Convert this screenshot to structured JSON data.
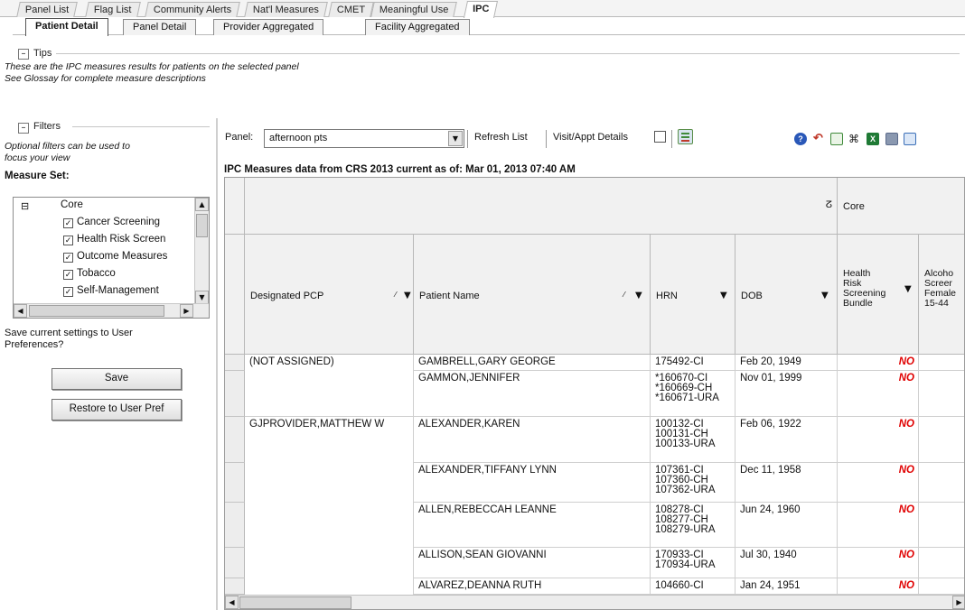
{
  "top_tabs": [
    "Panel List",
    "Flag List",
    "Community Alerts",
    "Nat'l Measures",
    "CMET",
    "Meaningful Use",
    "IPC"
  ],
  "sub_tabs": [
    "Patient Detail",
    "Panel Detail",
    "Provider Aggregated",
    "Facility Aggregated"
  ],
  "tips": {
    "toggle": "–",
    "label": "Tips",
    "line1": "These are the IPC measures results for patients on the selected panel",
    "line2": "See Glossay for complete measure descriptions"
  },
  "filters": {
    "toggle": "–",
    "label": "Filters",
    "desc_line1": "Optional filters can be used to",
    "desc_line2": "focus your view",
    "measure_set_label": "Measure Set:",
    "tree_root": "Core",
    "tree_root_toggle": "⊟",
    "tree_items": [
      "Cancer Screening",
      "Health Risk Screen",
      "Outcome Measures",
      "Tobacco",
      "Self-Management"
    ],
    "check_mark": "✓",
    "save_prompt_line1": "Save current settings to User",
    "save_prompt_line2": "Preferences?",
    "save_button": "Save",
    "restore_button": "Restore  to User Pref"
  },
  "toolbar": {
    "panel_label": "Panel:",
    "panel_value": "afternoon pts",
    "refresh_button": "Refresh List",
    "visit_details_label": "Visit/Appt Details",
    "icons": [
      "export-icon",
      "help-icon",
      "undo-icon",
      "doc-icon",
      "binoculars-icon",
      "excel-icon",
      "print-icon",
      "copy-icon"
    ],
    "colors": {
      "help": "#2a58b8",
      "undo": "#c03a2b",
      "doc": "#3f8a3a",
      "excel": "#1f7a35",
      "print": "#5a6a8a",
      "copy": "#3b6fb8"
    }
  },
  "data_caption": "IPC Measures data  from  CRS 2013 current as of:  Mar 01, 2013 07:40 AM",
  "grid": {
    "group_header": "Core",
    "pin_icon": "ⵒ",
    "filter_glyph": "▼",
    "columns": {
      "pcp": "Designated PCP",
      "patient": "Patient Name",
      "hrn": "HRN",
      "dob": "DOB",
      "hrs_lines": [
        "Health",
        "Risk",
        "Screening",
        "Bundle"
      ],
      "alc_lines": [
        "Alcoho",
        "Screer",
        "Female",
        "15-44"
      ]
    },
    "rows": [
      {
        "pcp": "(NOT ASSIGNED)",
        "patient": "GAMBRELL,GARY GEORGE",
        "hrn": [
          "175492-CI"
        ],
        "dob": "Feb 20, 1949",
        "hrs": "NO"
      },
      {
        "pcp": "",
        "patient": "GAMMON,JENNIFER",
        "hrn": [
          "*160670-CI",
          "*160669-CH",
          "*160671-URA"
        ],
        "dob": "Nov 01, 1999",
        "hrs": "NO"
      },
      {
        "pcp": "GJPROVIDER,MATTHEW W",
        "patient": "ALEXANDER,KAREN",
        "hrn": [
          "100132-CI",
          "100131-CH",
          "100133-URA"
        ],
        "dob": "Feb 06, 1922",
        "hrs": "NO"
      },
      {
        "pcp": "",
        "patient": "ALEXANDER,TIFFANY LYNN",
        "hrn": [
          "107361-CI",
          "107360-CH",
          "107362-URA"
        ],
        "dob": "Dec 11, 1958",
        "hrs": "NO"
      },
      {
        "pcp": "",
        "patient": "ALLEN,REBECCAH LEANNE",
        "hrn": [
          "108278-CI",
          "108277-CH",
          "108279-URA"
        ],
        "dob": "Jun 24, 1960",
        "hrs": "NO"
      },
      {
        "pcp": "",
        "patient": "ALLISON,SEAN GIOVANNI",
        "hrn": [
          "170933-CI",
          "170934-URA"
        ],
        "dob": "Jul 30, 1940",
        "hrs": "NO"
      },
      {
        "pcp": "",
        "patient": "ALVAREZ,DEANNA RUTH",
        "hrn": [
          "104660-CI"
        ],
        "dob": "Jan 24, 1951",
        "hrs": "NO"
      }
    ]
  }
}
